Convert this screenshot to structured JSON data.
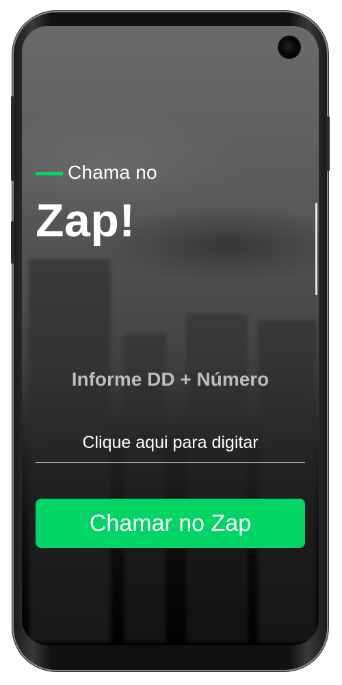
{
  "hero": {
    "tagline": "Chama no",
    "headline": "Zap!"
  },
  "form": {
    "prompt": "Informe DD + Número",
    "input_value": "",
    "input_placeholder": "Clique aqui para digitar",
    "submit_label": "Chamar no Zap"
  },
  "colors": {
    "accent": "#00d565",
    "text": "#ffffff",
    "prompt_text": "#bdbdbd"
  },
  "icons": {
    "camera": "front-camera-icon"
  }
}
